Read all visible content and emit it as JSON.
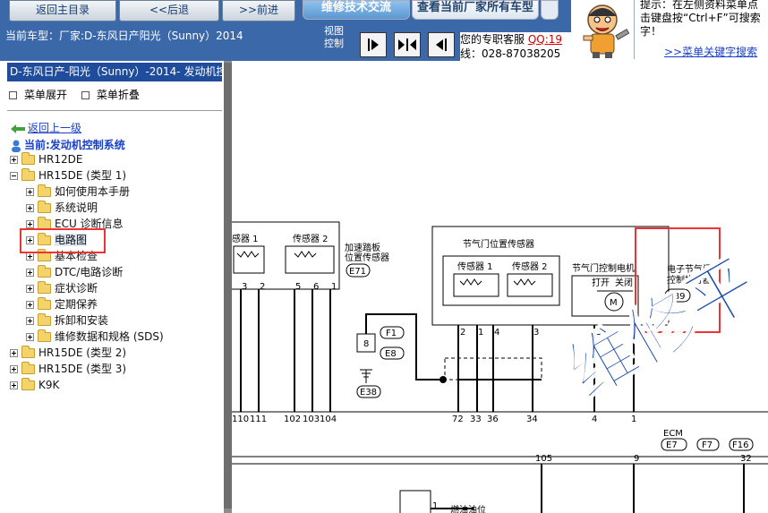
{
  "nav": {
    "home_label": "返回主目录",
    "back_label": "<<后退",
    "forward_label": ">>前进"
  },
  "tabs": {
    "forum": "维修技术交流",
    "all_cars": "查看当前厂家所有车型"
  },
  "info": {
    "current_car": "当前车型：厂家:D-东风日产阳光（Sunny）2014",
    "view_control": "视图控制",
    "support_line1": "您的专职客服",
    "support_qq": "QQ:19",
    "support_line2": "线：028-87038205"
  },
  "tip": {
    "text": "提示：在左侧资料菜单点击键盘按“Ctrl+F”可搜索字！",
    "link": ">>菜单关键字搜索演"
  },
  "panel": {
    "title": "D-东风日产-阳光（Sunny）-2014- 发动机控制",
    "expand": "菜单展开",
    "collapse": "菜单折叠",
    "back": "返回上一级",
    "current": "当前:发动机控制系统"
  },
  "tree": [
    {
      "label": "HR12DE"
    },
    {
      "label": "HR15DE (类型 1)"
    },
    {
      "label": "如何使用本手册"
    },
    {
      "label": "系统说明"
    },
    {
      "label": "ECU 诊断信息"
    },
    {
      "label": "电路图"
    },
    {
      "label": "基本检查"
    },
    {
      "label": "DTC/电路诊断"
    },
    {
      "label": "症状诊断"
    },
    {
      "label": "定期保养"
    },
    {
      "label": "拆卸和安装"
    },
    {
      "label": "维修数据和规格 (SDS)"
    },
    {
      "label": "HR15DE (类型 2)"
    },
    {
      "label": "HR15DE (类型 3)"
    },
    {
      "label": "K9K"
    }
  ],
  "diagram": {
    "sensor1_left": "感器 1",
    "sensor2_left": "传感器 2",
    "pedal_label_1": "加速踏板",
    "pedal_label_2": "位置传感器",
    "pedal_conn": "E71",
    "tps_title": "节气门位置传感器",
    "tps_s1": "传感器 1",
    "tps_s2": "传感器 2",
    "motor_title": "节气门控制电机",
    "motor_open": "打开",
    "motor_close": "关闭",
    "motor_symbol": "M",
    "actuator_1": "电子节气门",
    "actuator_2": "控制执行器",
    "actuator_conn": "F89",
    "pin_3a": "3",
    "pin_2a": "2",
    "pin_5a": "5",
    "pin_6a": "6",
    "pin_1a": "1",
    "pin_2b": "2",
    "pin_1b": "1",
    "pin_4b": "4",
    "pin_3b": "3",
    "pin_5b": "5",
    "pin_6b": "6",
    "f1": "F1",
    "e8": "E8",
    "e38": "E38",
    "n8": "8",
    "ecm_110": "110",
    "ecm_111": "111",
    "ecm_102": "102",
    "ecm_103": "103",
    "ecm_104": "104",
    "ecm_72": "72",
    "ecm_33": "33",
    "ecm_36": "36",
    "ecm_34": "34",
    "ecm_4": "4",
    "ecm_1": "1",
    "ecm_label": "ECM",
    "e7": "E7",
    "f7": "F7",
    "f16": "F16",
    "b105": "105",
    "b9": "9",
    "b32": "32",
    "b1": "1",
    "fuel_label": "燃油油位"
  },
  "watermark": "维修平"
}
